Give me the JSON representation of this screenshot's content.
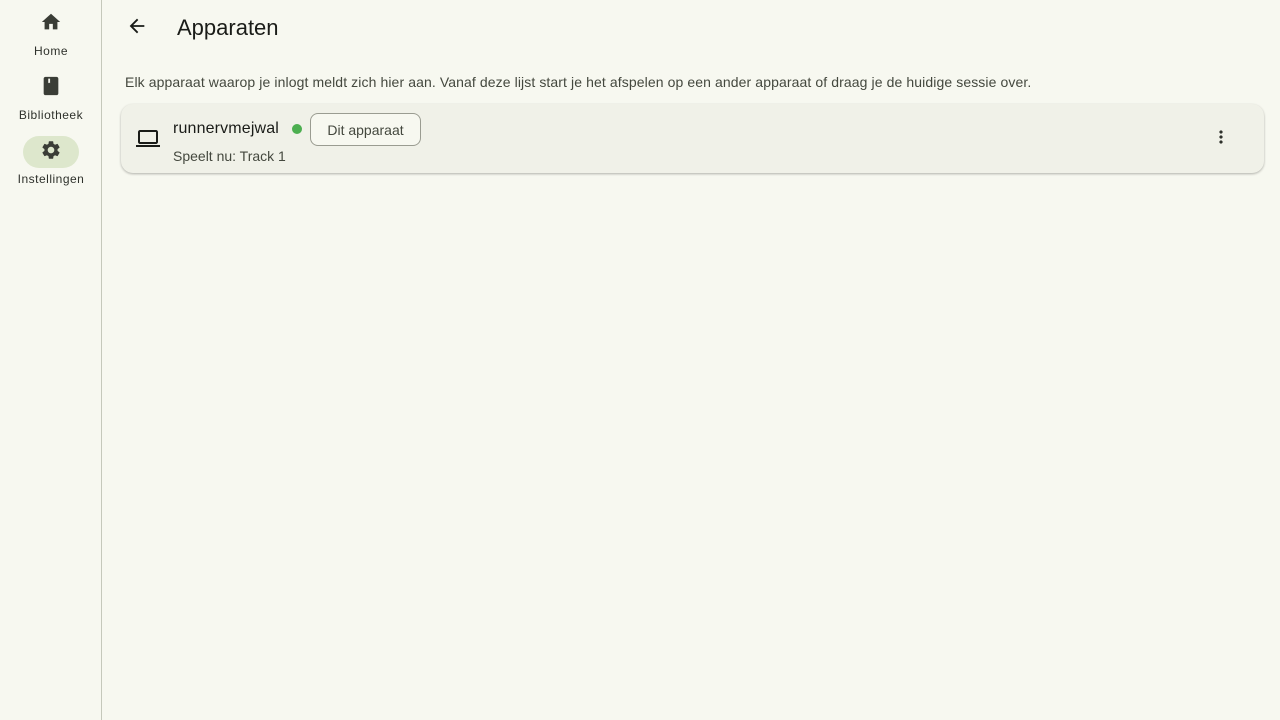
{
  "nav": {
    "items": [
      {
        "label": "Home",
        "icon": "home-icon"
      },
      {
        "label": "Bibliotheek",
        "icon": "book-icon"
      },
      {
        "label": "Instellingen",
        "icon": "gear-icon",
        "active": true
      }
    ]
  },
  "header": {
    "title": "Apparaten",
    "back_icon": "arrow-left-icon"
  },
  "description": "Elk apparaat waarop je inlogt meldt zich hier aan. Vanaf deze lijst start je het afspelen op een ander apparaat of draag je de huidige sessie over.",
  "devices": [
    {
      "icon": "laptop-icon",
      "name": "runnervmejwal",
      "status": "online",
      "status_color": "#4caf50",
      "chip_label": "Dit apparaat",
      "now_playing": "Speelt nu: Track 1",
      "menu_icon": "more-vert-icon"
    }
  ],
  "colors": {
    "background": "#f7f8f0",
    "active_pill": "#dde7cc",
    "card": "#f0f1e8"
  }
}
